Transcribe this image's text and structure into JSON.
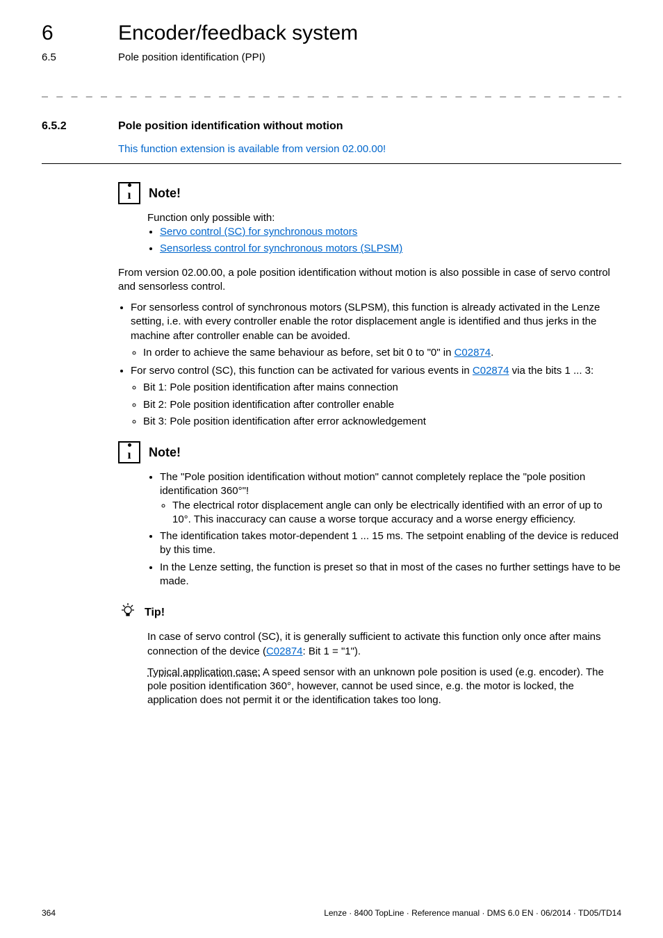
{
  "header": {
    "chapter_num": "6",
    "chapter_title": "Encoder/feedback system",
    "sub_num": "6.5",
    "sub_title": "Pole position identification (PPI)"
  },
  "dash_rule": "_ _ _ _ _ _ _ _ _ _ _ _ _ _ _ _ _ _ _ _ _ _ _ _ _ _ _ _ _ _ _ _ _ _ _ _ _ _ _ _ _ _ _ _ _ _ _ _ _ _ _ _ _ _ _ _ _ _ _ _ _ _ _ _",
  "section": {
    "num": "6.5.2",
    "title": "Pole position identification without motion",
    "intro_link": "This function extension is available from version 02.00.00!"
  },
  "note1": {
    "label": "Note!",
    "lead": "Function only possible with:",
    "items": [
      "Servo control (SC) for synchronous motors",
      "Sensorless control for synchronous motors (SLPSM)"
    ]
  },
  "para1": "From version 02.00.00, a pole position identification without motion is also possible in case of servo control and sensorless control.",
  "list1": {
    "item1": "For sensorless control of synchronous motors (SLPSM), this function is already activated in the Lenze setting, i.e. with every controller enable the rotor displacement angle is identified and thus jerks in the machine after controller enable can be avoided.",
    "item1_sub_pre": "In order to achieve the same behaviour as before, set bit 0 to \"0\" in ",
    "item1_sub_link": "C02874",
    "item1_sub_post": ".",
    "item2_pre": "For servo control (SC), this function can be activated for various events in ",
    "item2_link": "C02874",
    "item2_post": " via the bits 1 ... 3:",
    "item2_subs": [
      "Bit 1: Pole position identification after mains connection",
      "Bit 2: Pole position identification after controller enable",
      "Bit 3: Pole position identification after error acknowledgement"
    ]
  },
  "note2": {
    "label": "Note!",
    "b1": "The \"Pole position identification without motion\" cannot completely replace the \"pole position identification 360°\"!",
    "b1_sub": "The electrical rotor displacement angle can only be electrically identified with an error of up to 10°. This inaccuracy can cause a worse torque accuracy and a worse energy efficiency.",
    "b2": "The identification takes motor-dependent 1 ... 15 ms. The setpoint enabling of the device is reduced by this time.",
    "b3": "In the Lenze setting, the function is preset so that in most of the cases no further settings have to be made."
  },
  "tip": {
    "label": "Tip!",
    "p1_pre": "In case of servo control (SC), it is generally sufficient to activate this function only once after mains connection of the device (",
    "p1_link": "C02874",
    "p1_post": ": Bit 1 = \"1\").",
    "p2_lead": "Typical application case:",
    "p2_rest": " A speed sensor with an unknown pole position is used (e.g. encoder). The pole position identification 360°, however, cannot be used since, e.g. the motor is locked, the application does not permit it or the identification takes too long."
  },
  "footer": {
    "page": "364",
    "right": "Lenze · 8400 TopLine · Reference manual · DMS 6.0 EN · 06/2014 · TD05/TD14"
  }
}
